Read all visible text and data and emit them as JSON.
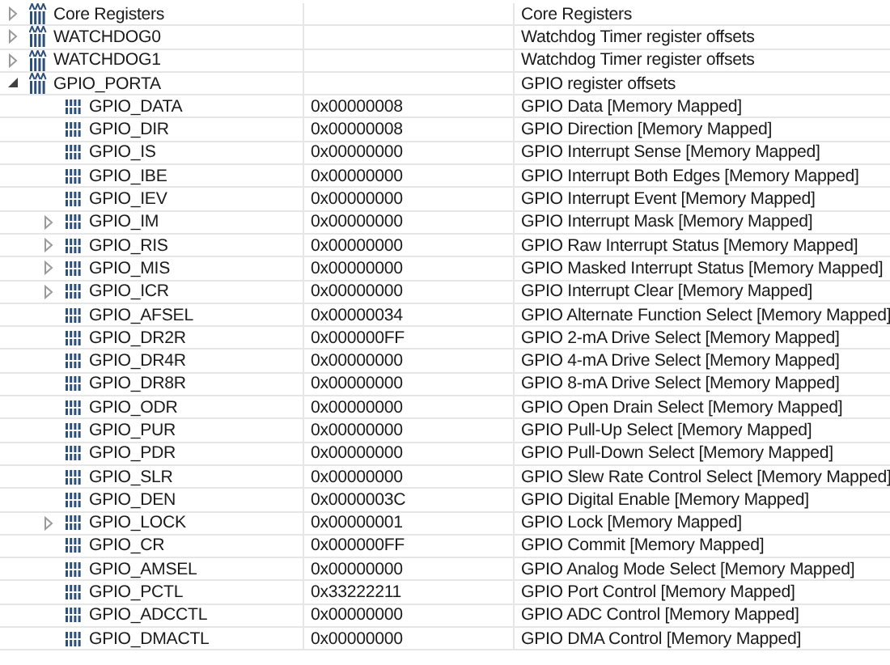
{
  "registers": [
    {
      "name": "Core Registers",
      "kind": "group",
      "expanded": false,
      "description": "Core Registers"
    },
    {
      "name": "WATCHDOG0",
      "kind": "group",
      "expanded": false,
      "description": "Watchdog Timer register offsets"
    },
    {
      "name": "WATCHDOG1",
      "kind": "group",
      "expanded": false,
      "description": "Watchdog Timer register offsets"
    },
    {
      "name": "GPIO_PORTA",
      "kind": "group",
      "expanded": true,
      "description": "GPIO register offsets",
      "children": [
        {
          "name": "GPIO_DATA",
          "kind": "register",
          "value": "0x00000008",
          "description": "GPIO Data [Memory Mapped]"
        },
        {
          "name": "GPIO_DIR",
          "kind": "register",
          "value": "0x00000008",
          "description": "GPIO Direction [Memory Mapped]"
        },
        {
          "name": "GPIO_IS",
          "kind": "register",
          "value": "0x00000000",
          "description": "GPIO Interrupt Sense [Memory Mapped]"
        },
        {
          "name": "GPIO_IBE",
          "kind": "register",
          "value": "0x00000000",
          "description": "GPIO Interrupt Both Edges [Memory Mapped]"
        },
        {
          "name": "GPIO_IEV",
          "kind": "register",
          "value": "0x00000000",
          "description": "GPIO Interrupt Event [Memory Mapped]"
        },
        {
          "name": "GPIO_IM",
          "kind": "register",
          "expanded": false,
          "value": "0x00000000",
          "description": "GPIO Interrupt Mask [Memory Mapped]"
        },
        {
          "name": "GPIO_RIS",
          "kind": "register",
          "expanded": false,
          "value": "0x00000000",
          "description": "GPIO Raw Interrupt Status [Memory Mapped]"
        },
        {
          "name": "GPIO_MIS",
          "kind": "register",
          "expanded": false,
          "value": "0x00000000",
          "description": "GPIO Masked Interrupt Status [Memory Mapped]"
        },
        {
          "name": "GPIO_ICR",
          "kind": "register",
          "expanded": false,
          "value": "0x00000000",
          "description": "GPIO Interrupt Clear [Memory Mapped]"
        },
        {
          "name": "GPIO_AFSEL",
          "kind": "register",
          "value": "0x00000034",
          "description": "GPIO Alternate Function Select [Memory Mapped]"
        },
        {
          "name": "GPIO_DR2R",
          "kind": "register",
          "value": "0x000000FF",
          "description": "GPIO 2-mA Drive Select [Memory Mapped]"
        },
        {
          "name": "GPIO_DR4R",
          "kind": "register",
          "value": "0x00000000",
          "description": "GPIO 4-mA Drive Select [Memory Mapped]"
        },
        {
          "name": "GPIO_DR8R",
          "kind": "register",
          "value": "0x00000000",
          "description": "GPIO 8-mA Drive Select [Memory Mapped]"
        },
        {
          "name": "GPIO_ODR",
          "kind": "register",
          "value": "0x00000000",
          "description": "GPIO Open Drain Select [Memory Mapped]"
        },
        {
          "name": "GPIO_PUR",
          "kind": "register",
          "value": "0x00000000",
          "description": "GPIO Pull-Up Select [Memory Mapped]"
        },
        {
          "name": "GPIO_PDR",
          "kind": "register",
          "value": "0x00000000",
          "description": "GPIO Pull-Down Select [Memory Mapped]"
        },
        {
          "name": "GPIO_SLR",
          "kind": "register",
          "value": "0x00000000",
          "description": "GPIO Slew Rate Control Select [Memory Mapped]"
        },
        {
          "name": "GPIO_DEN",
          "kind": "register",
          "value": "0x0000003C",
          "description": "GPIO Digital Enable [Memory Mapped]"
        },
        {
          "name": "GPIO_LOCK",
          "kind": "register",
          "expanded": false,
          "value": "0x00000001",
          "description": "GPIO Lock [Memory Mapped]"
        },
        {
          "name": "GPIO_CR",
          "kind": "register",
          "value": "0x000000FF",
          "description": "GPIO Commit [Memory Mapped]"
        },
        {
          "name": "GPIO_AMSEL",
          "kind": "register",
          "value": "0x00000000",
          "description": "GPIO Analog Mode Select [Memory Mapped]"
        },
        {
          "name": "GPIO_PCTL",
          "kind": "register",
          "value": "0x33222211",
          "description": "GPIO Port Control [Memory Mapped]"
        },
        {
          "name": "GPIO_ADCCTL",
          "kind": "register",
          "value": "0x00000000",
          "description": "GPIO ADC Control [Memory Mapped]"
        },
        {
          "name": "GPIO_DMACTL",
          "kind": "register",
          "value": "0x00000000",
          "description": "GPIO DMA Control [Memory Mapped]"
        }
      ]
    }
  ]
}
